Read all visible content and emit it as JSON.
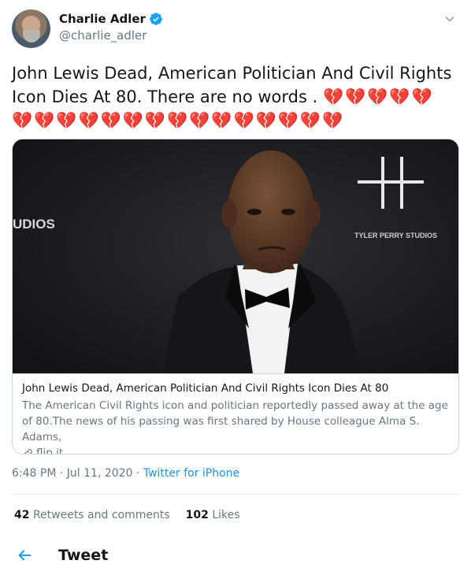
{
  "author": {
    "display_name": "Charlie Adler",
    "handle": "@charlie_adler",
    "verified": true
  },
  "tweet": {
    "text": "John Lewis Dead, American Politician And Civil Rights Icon Dies At 80.    There are no words .",
    "hearts_line1": "💔💔💔💔💔",
    "hearts_line2": "💔💔💔💔💔💔💔💔💔💔💔💔💔💔💔"
  },
  "card": {
    "image_texts": {
      "left": "UDIOS",
      "right": "TYLER PERRY STUDIOS"
    },
    "title": "John Lewis Dead, American Politician And Civil Rights Icon Dies At 80",
    "description": "The American Civil Rights icon and politician reportedly passed away at the age of 80.The news of his passing was first shared by House colleague Alma S. Adams,",
    "domain": "flip.it"
  },
  "meta": {
    "time": "6:48 PM",
    "separator1": " · ",
    "date": "Jul 11, 2020",
    "separator2": " · ",
    "source": "Twitter for iPhone"
  },
  "stats": {
    "retweets_count": "42",
    "retweets_label": "Retweets and comments",
    "likes_count": "102",
    "likes_label": "Likes"
  },
  "bottom_bar": {
    "title": "Tweet"
  },
  "colors": {
    "accent": "#1b95e0",
    "verified": "#1da1f2",
    "muted": "#657786",
    "heart": "#d2232f"
  }
}
